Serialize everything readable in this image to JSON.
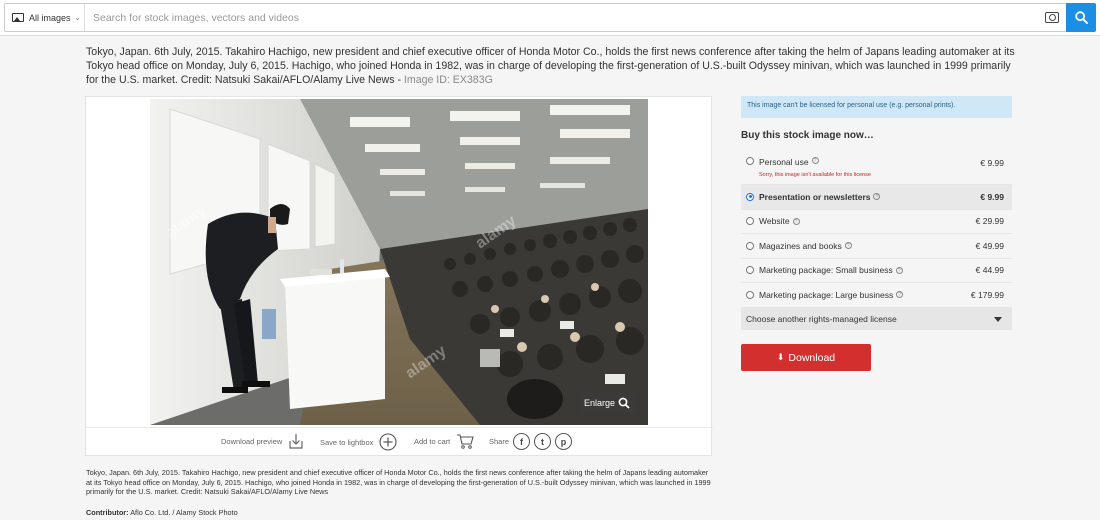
{
  "search": {
    "scope_label": "All images",
    "placeholder": "Search for stock images, vectors and videos",
    "value": ""
  },
  "caption": {
    "title": "Tokyo, Japan. 6th July, 2015. Takahiro Hachigo, new president and chief executive officer of Honda Motor Co., holds the first news conference after taking the helm of Japans leading automaker at its Tokyo head office on Monday, July 6, 2015. Hachigo, who joined Honda in 1982, was in charge of developing the first-generation of U.S.-built Odyssey minivan, which was launched in 1999 primarily for the U.S. market. Credit: Natsuki Sakai/AFLO/Alamy Live News - ",
    "image_id": "Image ID: EX383G"
  },
  "image": {
    "enlarge_label": "Enlarge"
  },
  "actions": {
    "download_preview": "Download preview",
    "save_to_lightbox": "Save to lightbox",
    "add_to_cart": "Add to cart",
    "share": "Share",
    "share_icons": [
      "f",
      "t",
      "p"
    ]
  },
  "license": {
    "notice": "This image can't be licensed for personal use (e.g. personal prints).",
    "heading": "Buy this stock image now…",
    "options": [
      {
        "label": "Personal use",
        "price": "€ 9.99",
        "note": "Sorry, this image isn't available for this license",
        "selected": false
      },
      {
        "label": "Presentation or newsletters",
        "price": "€ 9.99",
        "selected": true
      },
      {
        "label": "Website",
        "price": "€ 29.99",
        "selected": false
      },
      {
        "label": "Magazines and books",
        "price": "€ 49.99",
        "selected": false
      },
      {
        "label": "Marketing package: Small business",
        "price": "€ 44.99",
        "selected": false
      },
      {
        "label": "Marketing package: Large business",
        "price": "€ 179.99",
        "selected": false
      }
    ],
    "other_license": "Choose another rights-managed license",
    "download_label": "Download"
  },
  "description": "Tokyo, Japan. 6th July, 2015. Takahiro Hachigo, new president and chief executive officer of Honda Motor Co., holds the first news conference after taking the helm of Japans leading automaker at its Tokyo head office on Monday, July 6, 2015. Hachigo, who joined Honda in 1982, was in charge of developing the first-generation of U.S.-built Odyssey minivan, which was launched in 1999 primarily for the U.S. market. Credit: Natsuki Sakai/AFLO/Alamy Live News",
  "contributor": {
    "label": "Contributor:",
    "value": "Aflo Co. Ltd. / Alamy Stock Photo"
  },
  "colors": {
    "accent_blue": "#1a8fe3",
    "download_red": "#d32f2f",
    "notice_bg": "#cfe7f7"
  }
}
